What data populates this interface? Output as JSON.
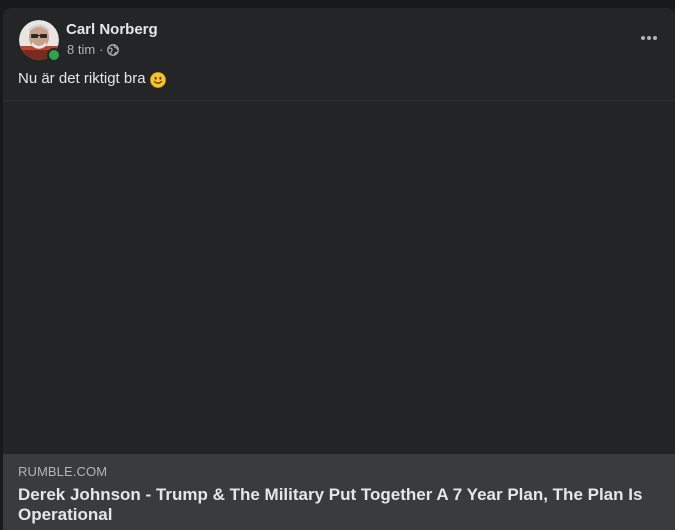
{
  "post": {
    "author": "Carl Norberg",
    "time": "8 tim",
    "separator": "·",
    "privacy_icon": "globe-icon",
    "text": "Nu är det riktigt bra",
    "emoji_icon": "smiley-icon",
    "more_icon": "more-options-icon",
    "online": true
  },
  "link_preview": {
    "domain": "RUMBLE.COM",
    "title": "Derek Johnson - Trump & The Military Put Together A 7 Year Plan, The Plan Is Operational"
  },
  "colors": {
    "page_background": "#18191a",
    "card_background": "#242526",
    "preview_background": "#3a3b3c",
    "primary_text": "#e4e6eb",
    "secondary_text": "#b0b3b8",
    "online_indicator": "#31a24c"
  }
}
